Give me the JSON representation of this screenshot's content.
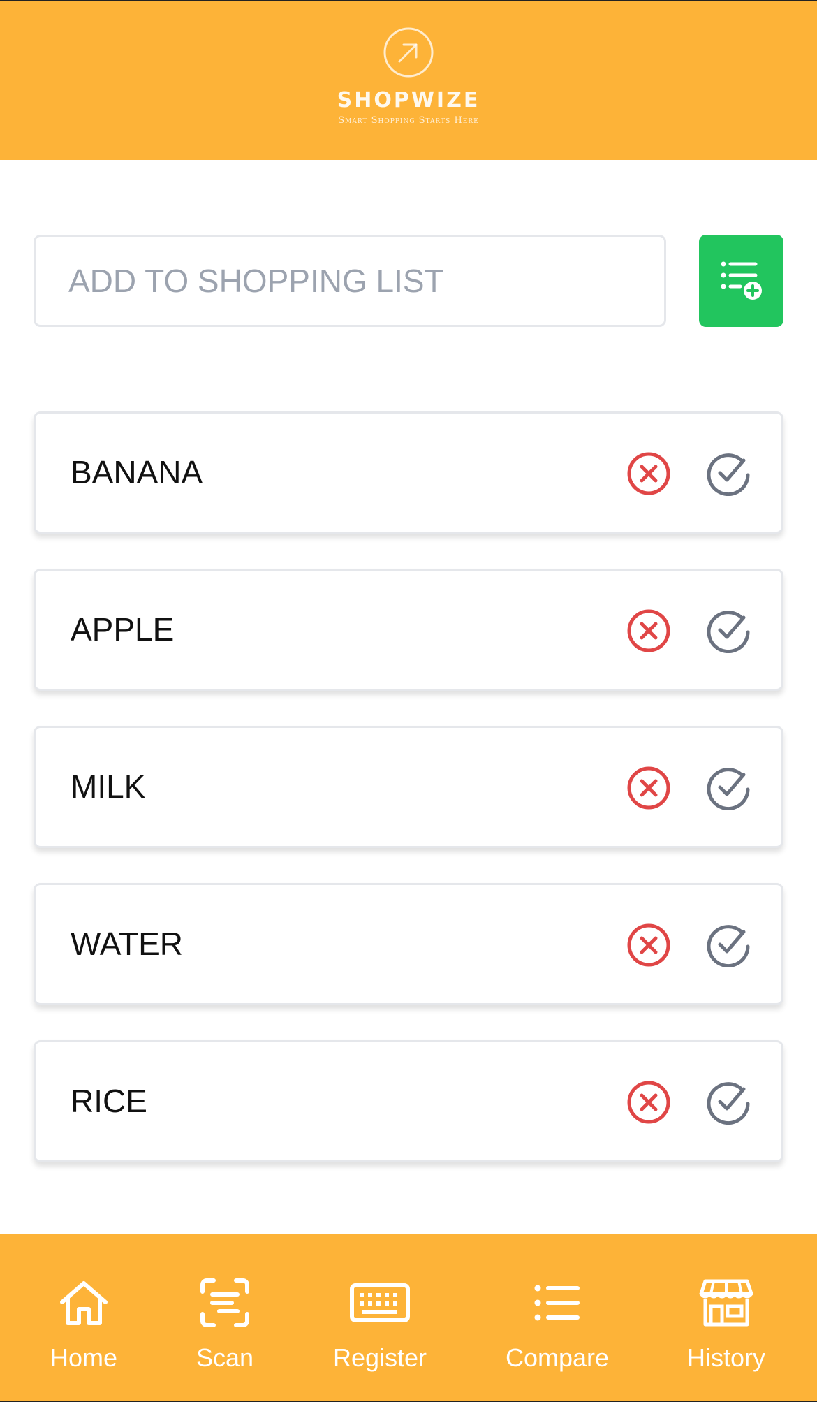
{
  "header": {
    "logo_name": "SHOPWIZE",
    "logo_tagline": "Smart Shopping Starts Here"
  },
  "add_form": {
    "placeholder": "ADD TO SHOPPING LIST",
    "button_icon": "list-add-icon"
  },
  "items": [
    {
      "label": "BANANA"
    },
    {
      "label": "APPLE"
    },
    {
      "label": "MILK"
    },
    {
      "label": "WATER"
    },
    {
      "label": "RICE"
    }
  ],
  "item_icons": {
    "remove": "x-circle-icon",
    "check": "check-circle-icon"
  },
  "nav": [
    {
      "label": "Home",
      "icon": "home-icon"
    },
    {
      "label": "Scan",
      "icon": "scan-icon"
    },
    {
      "label": "Register",
      "icon": "keyboard-icon"
    },
    {
      "label": "Compare",
      "icon": "list-icon"
    },
    {
      "label": "History",
      "icon": "store-icon"
    }
  ],
  "colors": {
    "brand": "#FDB338",
    "add_button": "#22C55E",
    "remove": "#E04646",
    "check": "#6B7280"
  }
}
